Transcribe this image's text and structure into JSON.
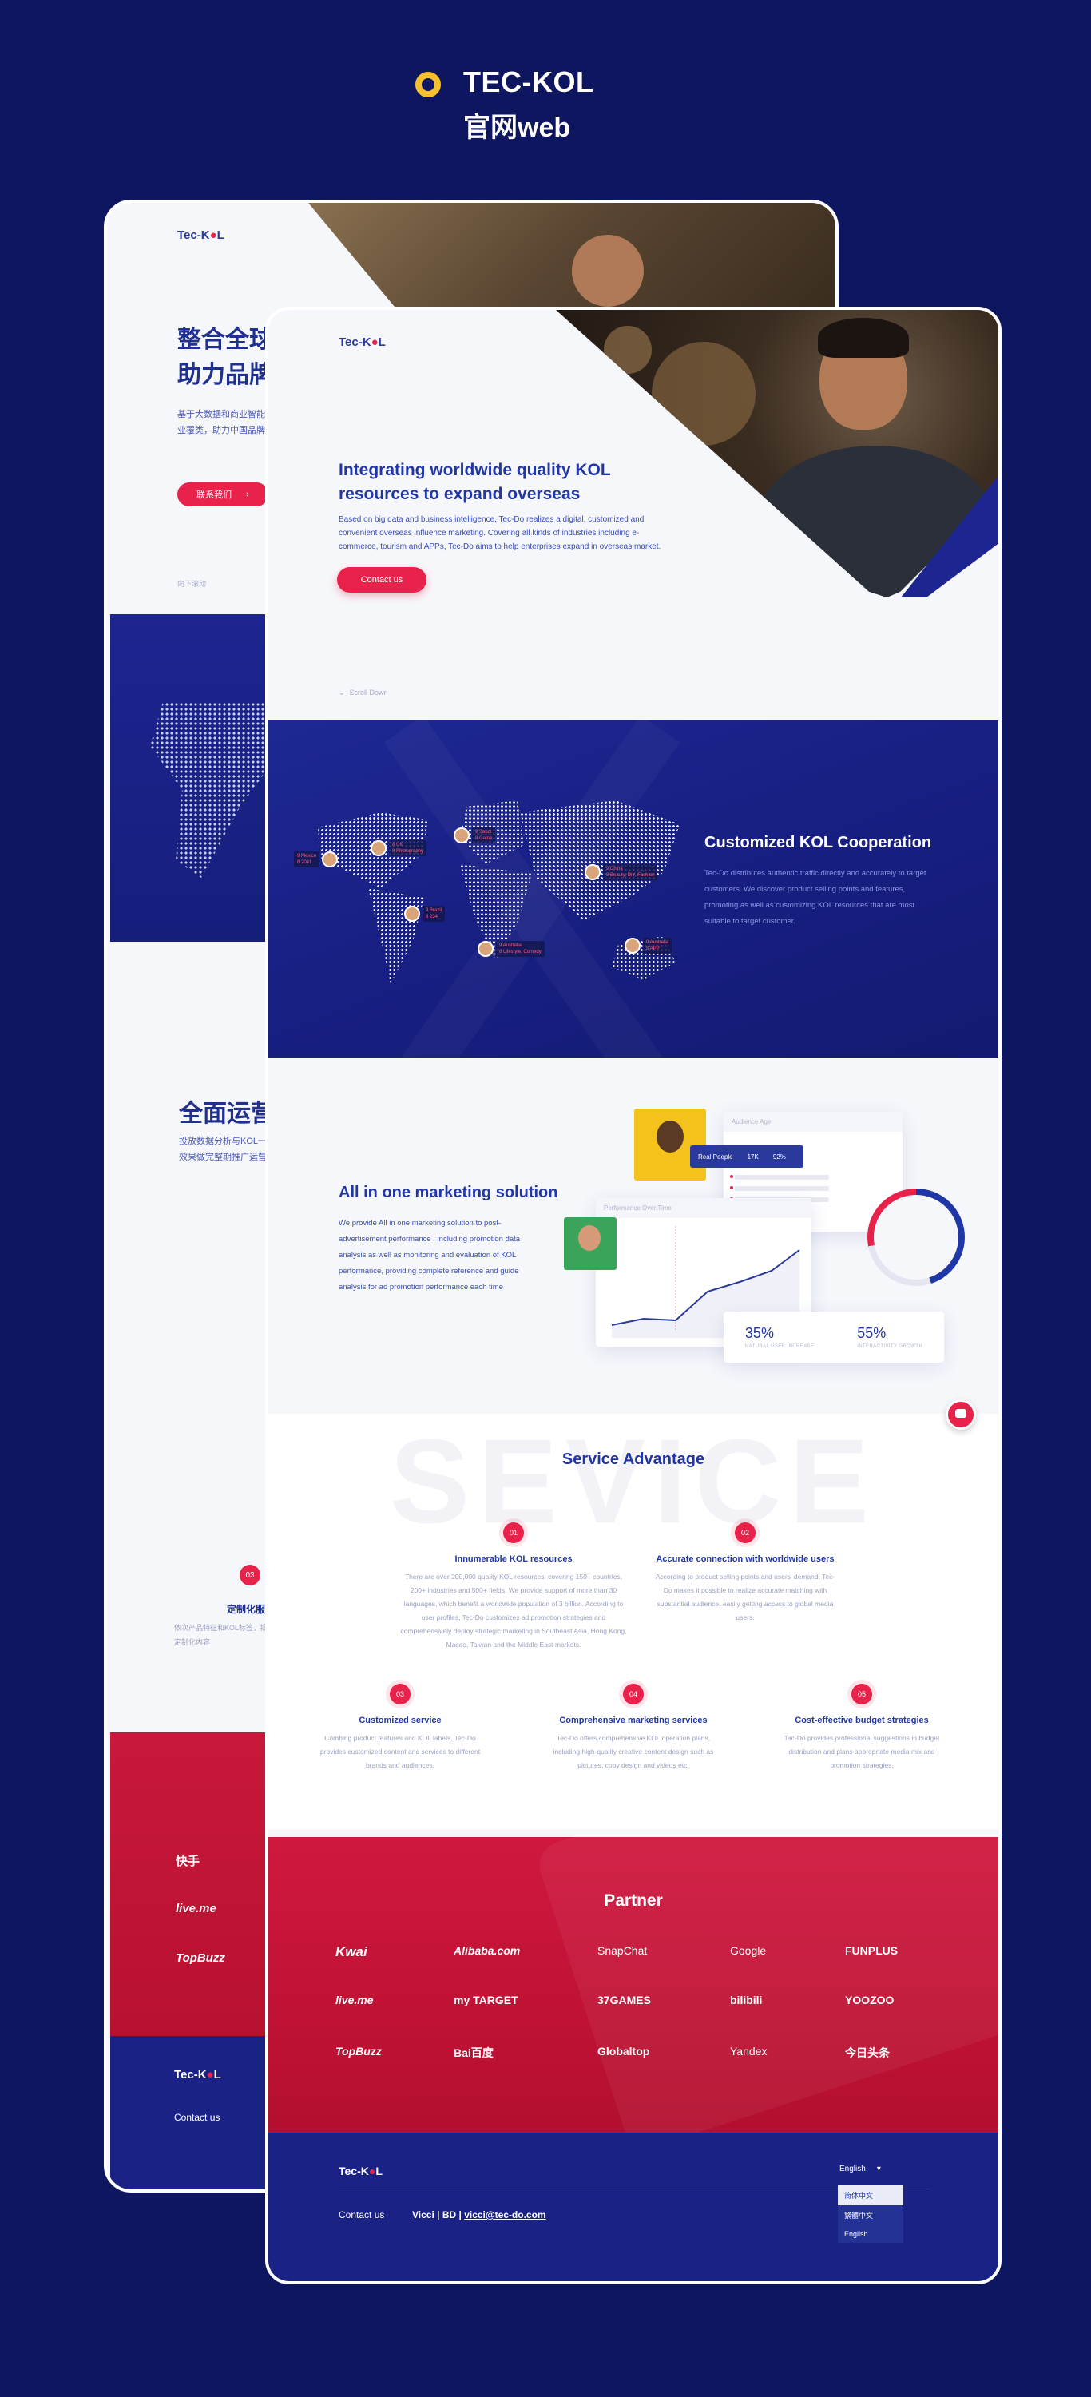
{
  "heading": {
    "title": "TEC-KOL",
    "subtitle": "官网web"
  },
  "back_card": {
    "logo": "Tec-K●L",
    "hero_title_line1": "整合全球",
    "hero_title_line2": "助力品牌",
    "hero_text": "基于大数据和商业智能和便捷化，服务行业覆类，助力中国品牌出海",
    "cta": "联系我们",
    "scroll": "向下滚动",
    "ops_title": "全面运营",
    "ops_text": "投放数据分析与KOL一次推广效果做完整期推广运营服务。",
    "svc_num": "03",
    "svc_title": "定制化服",
    "svc_text": "依次产品特征和KOL标签，提供定制化内容",
    "partners": [
      "快手",
      "live.me",
      "TopBuzz"
    ],
    "footer_logo": "Tec-K●L",
    "footer_contact": "Contact us"
  },
  "front_card": {
    "logo": "Tec-K●L",
    "hero": {
      "title": "Integrating worldwide quality KOL resources to expand overseas",
      "text": "Based on big data and business intelligence, Tec-Do realizes a digital, customized and convenient overseas influence marketing. Covering all kinds of industries including e-commerce, tourism and APPs, Tec-Do aims to help enterprises expand in overseas market.",
      "cta": "Contact us",
      "scroll": "Scroll Down"
    },
    "kol": {
      "title": "Customized KOL Cooperation",
      "text": "Tec-Do distributes authentic traffic directly and accurately to target customers. We discover product selling points and features, promoting as well as customizing KOL resources that are most suitable to target customer.",
      "pins": [
        "9 Mexico\n8 2041",
        "8 UK\n8 Photography",
        "9 Saudi\n8 Game",
        "9 China\n8 Beauty, DIY, Fashion",
        "9 Brazil\n8 234",
        "9 Australia\n8 Lifestyle, Comedy",
        "9 Australia\n8 APP"
      ]
    },
    "marketing": {
      "title": "All in one marketing solution",
      "text": "We provide All in one marketing solution to post-advertisement performance , including promotion data analysis as well as monitoring and evaluation of KOL performance, providing complete reference and guide analysis for ad promotion performance each time",
      "audience_title": "Audience Age",
      "real_people": "Real People",
      "real_count": "17K",
      "real_pct": "92%",
      "perf_title": "Performance Over Time",
      "stat1_value": "35%",
      "stat1_label": "NATURAL USER INCREASE",
      "stat2_value": "55%",
      "stat2_label": "INTERACTIVITY GROWTH"
    },
    "services": {
      "watermark": "SEVICE",
      "title": "Service Advantage",
      "items": [
        {
          "num": "01",
          "title": "Innumerable KOL resources",
          "text": "There are over 200,000 quality KOL resources, covering 150+ countries, 200+ industries and 500+ fields. We provide support of more than 30 languages, which benefit a worldwide population of 3 billion. According to user profiles, Tec-Do customizes ad promotion strategies and comprehensively deploy strategic marketing in Southeast Asia, Hong Kong, Macao, Taiwan and the Middle East markets."
        },
        {
          "num": "02",
          "title": "Accurate connection with worldwide users",
          "text": "According to product selling points and users' demand, Tec-Do makes it possible to realize accurate matching with substantial audience, easily getting access to global media users."
        },
        {
          "num": "03",
          "title": "Customized service",
          "text": "Combing product features and KOL labels, Tec-Do provides customized content and services to different brands and audiences."
        },
        {
          "num": "04",
          "title": "Comprehensive marketing services",
          "text": "Tec-Do offers comprehensive KOL operation plans, including high-quality creative content design such as pictures, copy design and videos etc."
        },
        {
          "num": "05",
          "title": "Cost-effective budget strategies",
          "text": "Tec-Do provides professional suggestions in budget distribution and plans appropriate media mix and promotion strategies."
        }
      ]
    },
    "partner": {
      "title": "Partner",
      "logos": [
        "Kwai",
        "Alibaba.com",
        "SnapChat",
        "Google",
        "FUNPLUS",
        "live.me",
        "my TARGET",
        "37GAMES",
        "bilibili",
        "YOOZOO",
        "TopBuzz",
        "Bai百度",
        "Globaltop",
        "Yandex",
        "今日头条"
      ]
    },
    "footer": {
      "logo": "Tec-K●L",
      "contact": "Contact us",
      "contact_name": "Vicci | BD |",
      "contact_email": "vicci@tec-do.com",
      "lang_current": "English",
      "lang_options": [
        "简体中文",
        "繁體中文",
        "English"
      ]
    }
  }
}
